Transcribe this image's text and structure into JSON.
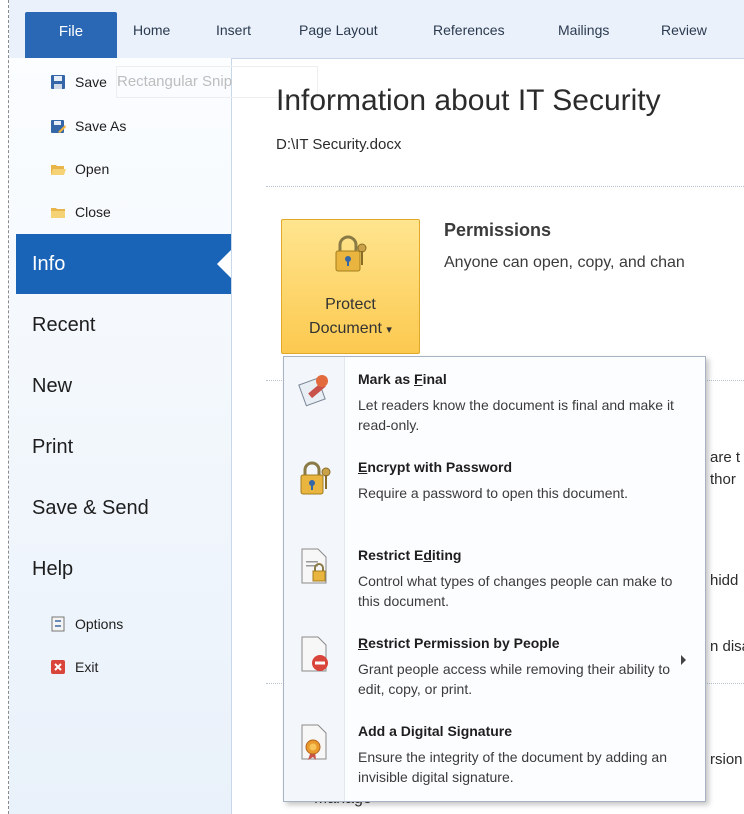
{
  "ribbon": {
    "tabs": [
      "File",
      "Home",
      "Insert",
      "Page Layout",
      "References",
      "Mailings",
      "Review"
    ]
  },
  "backstage": {
    "small_items": [
      {
        "label": "Save",
        "icon": "save-icon"
      },
      {
        "label": "Save As",
        "icon": "save-as-icon"
      },
      {
        "label": "Open",
        "icon": "open-folder-icon"
      },
      {
        "label": "Close",
        "icon": "close-folder-icon"
      }
    ],
    "big_items": [
      "Info",
      "Recent",
      "New",
      "Print",
      "Save & Send",
      "Help"
    ],
    "bottom_items": [
      {
        "label": "Options",
        "icon": "options-icon"
      },
      {
        "label": "Exit",
        "icon": "exit-icon"
      }
    ],
    "selected": "Info",
    "ghost_text": "Rectangular Snip"
  },
  "info": {
    "title": "Information about IT Security",
    "path": "D:\\IT Security.docx",
    "protect_button": {
      "line1": "Protect",
      "line2": "Document",
      "arrow": "▾"
    },
    "permissions": {
      "title": "Permissions",
      "desc": "Anyone can open, copy, and chan"
    },
    "background_fragments": [
      "are t",
      "thor",
      "hidd",
      "n disa",
      "rsion"
    ],
    "manage_label": "Manage"
  },
  "protect_menu": [
    {
      "title": "Mark as Final",
      "mnemonic_index": 8,
      "desc": "Let readers know the document is final and make it read-only.",
      "icon": "mark-final-icon"
    },
    {
      "title": "Encrypt with Password",
      "mnemonic_index": 0,
      "desc": "Require a password to open this document.",
      "icon": "encrypt-lock-icon"
    },
    {
      "title": "Restrict Editing",
      "mnemonic_index": 10,
      "desc": "Control what types of changes people can make to this document.",
      "icon": "restrict-editing-icon"
    },
    {
      "title": "Restrict Permission by People",
      "mnemonic_index": 0,
      "desc": "Grant people access while removing their ability to edit, copy, or print.",
      "icon": "restrict-permission-icon",
      "has_submenu": true
    },
    {
      "title": "Add a Digital Signature",
      "mnemonic_index": 16,
      "desc": "Ensure the integrity of the document by adding an invisible digital signature.",
      "icon": "digital-signature-icon"
    }
  ]
}
